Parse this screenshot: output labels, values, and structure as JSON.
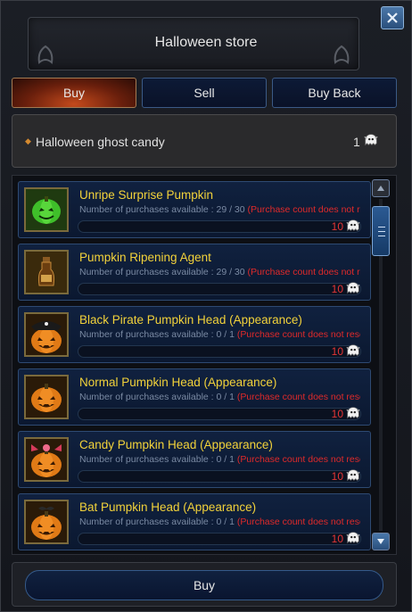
{
  "window": {
    "title": "Halloween store"
  },
  "tabs": [
    {
      "label": "Buy",
      "active": true
    },
    {
      "label": "Sell",
      "active": false
    },
    {
      "label": "Buy Back",
      "active": false
    }
  ],
  "currency": {
    "name": "Halloween ghost candy",
    "amount": "1",
    "icon": "ghost-candy-icon"
  },
  "items": [
    {
      "name": "Unripe Surprise Pumpkin",
      "avail_text": "Number of purchases available : 29 / 30",
      "warn_text": "(Purchase count does not reset)",
      "price": "10",
      "icon": "green-pumpkin-icon"
    },
    {
      "name": "Pumpkin Ripening Agent",
      "avail_text": "Number of purchases available : 29 / 30",
      "warn_text": "(Purchase count does not reset)",
      "price": "10",
      "icon": "potion-bottle-icon"
    },
    {
      "name": "Black Pirate Pumpkin Head (Appearance)",
      "avail_text": "Number of purchases available : 0 / 1",
      "warn_text": "(Purchase count does not reset)",
      "price": "10",
      "icon": "pirate-pumpkin-head-icon"
    },
    {
      "name": "Normal Pumpkin Head (Appearance)",
      "avail_text": "Number of purchases available : 0 / 1",
      "warn_text": "(Purchase count does not reset)",
      "price": "10",
      "icon": "pumpkin-head-icon"
    },
    {
      "name": "Candy Pumpkin Head (Appearance)",
      "avail_text": "Number of purchases available : 0 / 1",
      "warn_text": "(Purchase count does not reset)",
      "price": "10",
      "icon": "candy-pumpkin-head-icon"
    },
    {
      "name": "Bat Pumpkin Head (Appearance)",
      "avail_text": "Number of purchases available : 0 / 1",
      "warn_text": "(Purchase count does not reset)",
      "price": "10",
      "icon": "bat-pumpkin-head-icon"
    }
  ],
  "footer": {
    "buy_label": "Buy"
  },
  "colors": {
    "item_name": "#f2d23a",
    "price": "#e53535",
    "warn": "#e02a2a",
    "tab_active": "#c44a1c"
  }
}
